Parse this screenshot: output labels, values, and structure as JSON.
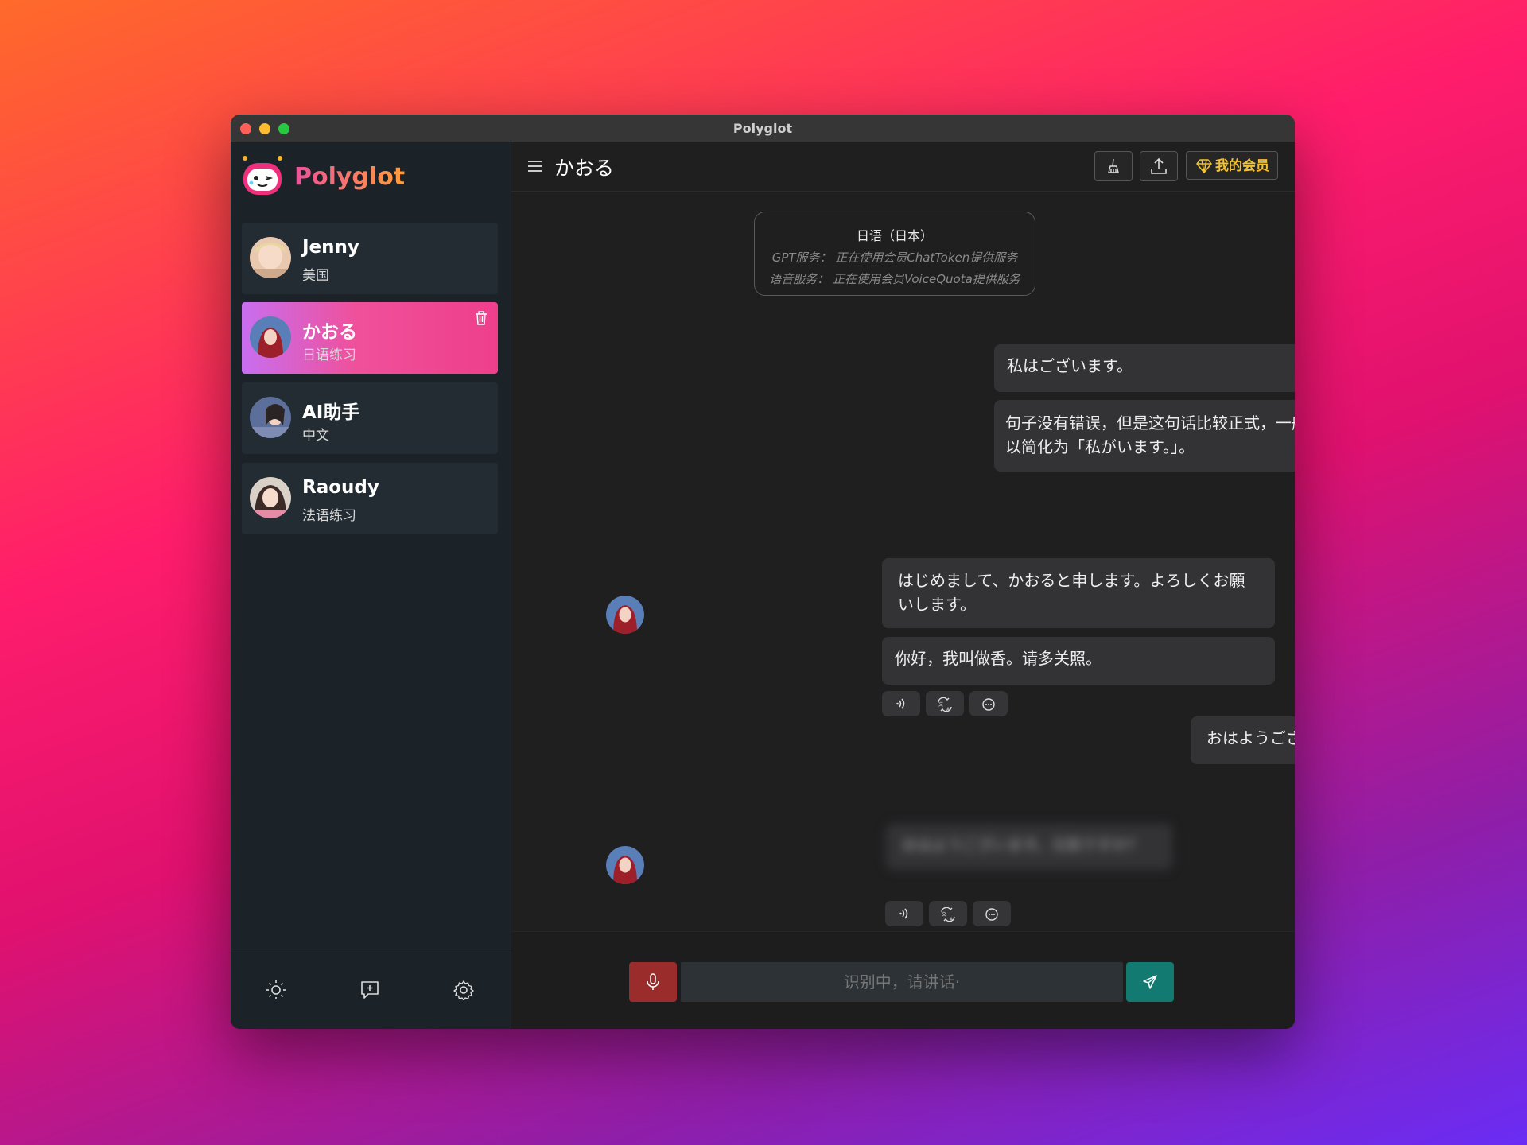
{
  "window": {
    "title": "Polyglot"
  },
  "sidebar": {
    "brand": "Polyglot",
    "contacts": [
      {
        "name": "Jenny",
        "subtitle": "美国"
      },
      {
        "name": "かおる",
        "subtitle": "日语练习"
      },
      {
        "name": "AI助手",
        "subtitle": "中文"
      },
      {
        "name": "Raoudy",
        "subtitle": "法语练习"
      }
    ],
    "bottom_icons": [
      "sun-icon",
      "chat-add-icon",
      "gear-icon"
    ]
  },
  "header": {
    "title": "かおる",
    "vip_label": "我的会员",
    "icons": [
      "menu-icon",
      "broom-icon",
      "upload-icon",
      "diamond-icon"
    ]
  },
  "info_card": {
    "language": "日语（日本）",
    "gpt_service": "GPT服务：  正在使用会员ChatToken提供服务",
    "voice_service": "语音服务：  正在使用会员VoiceQuota提供服务"
  },
  "messages": {
    "m1_text": "私はございます。",
    "m1_correction": "句子没有错误，但是这句话比较正式，一般情况下可以简化为「私がいます。」。",
    "m2_text": "はじめまして、かおると申します。よろしくお願いします。",
    "m2_translation": "你好，我叫做香。请多关照。",
    "m3_text": "おはようございます。",
    "m4_text": "おはようございます。元気ですか?"
  },
  "input": {
    "placeholder": "识别中，请讲话·"
  },
  "colors": {
    "accent_pink": "#f0509a",
    "vip_gold": "#f2c230",
    "mic_red": "#9a2c2c",
    "send_teal": "#127a70"
  }
}
